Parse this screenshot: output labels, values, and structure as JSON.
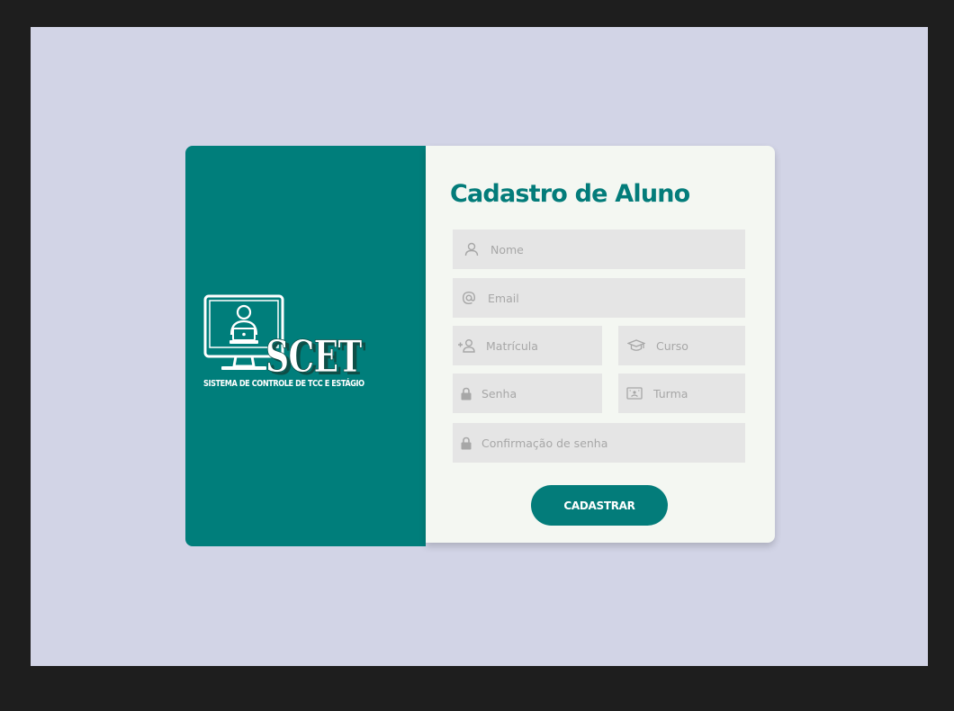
{
  "logo": {
    "wordmark": "SCET",
    "tagline": "SISTEMA DE CONTROLE DE TCC  E ESTÁGIO"
  },
  "form": {
    "title": "Cadastro de Aluno",
    "fields": {
      "nome": {
        "placeholder": "Nome",
        "icon": "user-icon"
      },
      "email": {
        "placeholder": "Email",
        "icon": "at-icon"
      },
      "matricula": {
        "placeholder": "Matrícula",
        "icon": "add-user-icon"
      },
      "curso": {
        "placeholder": "Curso",
        "icon": "graduation-cap-icon"
      },
      "senha": {
        "placeholder": "Senha",
        "icon": "lock-icon"
      },
      "turma": {
        "placeholder": "Turma",
        "icon": "id-card-icon"
      },
      "confirmacao": {
        "placeholder": "Confirmação de senha",
        "icon": "lock-icon"
      }
    },
    "submit_label": "CADASTRAR"
  },
  "colors": {
    "page_background": "#d2d4e6",
    "panel_teal": "#007e7b",
    "accent": "#037c7a",
    "form_background": "#f4f7f2",
    "input_background": "#e5e5e5",
    "placeholder": "#a7a7a7"
  }
}
